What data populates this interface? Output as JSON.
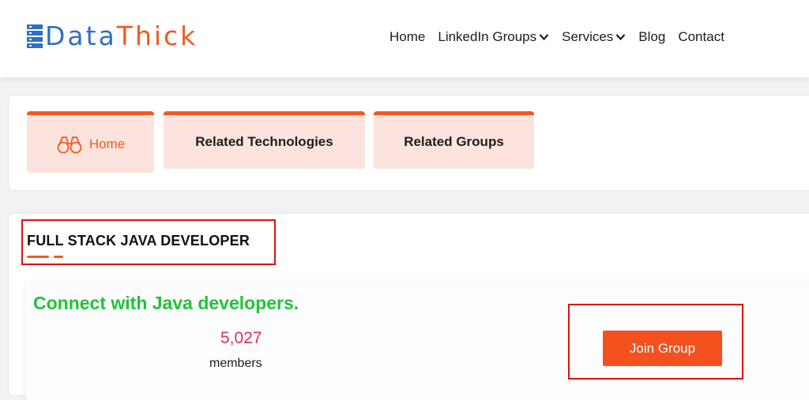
{
  "header": {
    "logo": {
      "part1": "Data",
      "part2": "Thick",
      "mark_icon": "server-stack-icon"
    },
    "nav": [
      {
        "label": "Home"
      },
      {
        "label": "LinkedIn Groups",
        "icon": "chevron-down-icon"
      },
      {
        "label": "Services",
        "icon": "chevron-down-icon"
      },
      {
        "label": "Blog"
      },
      {
        "label": "Contact"
      }
    ]
  },
  "tabs": {
    "home": {
      "label": "Home",
      "icon": "binoculars-icon"
    },
    "related_technologies": {
      "label": "Related Technologies"
    },
    "related_groups": {
      "label": "Related Groups"
    }
  },
  "group": {
    "title": "FULL STACK JAVA DEVELOPER",
    "tagline": "Connect with Java developers.",
    "members_count": "5,027",
    "members_label": "members",
    "join_label": "Join Group"
  },
  "colors": {
    "brand_blue": "#2f6fc8",
    "brand_orange": "#f15a24",
    "tab_bg": "#fde3dd",
    "tagline_green": "#22c23a",
    "count_pink": "#e0305a",
    "highlight_red": "#e01010"
  }
}
